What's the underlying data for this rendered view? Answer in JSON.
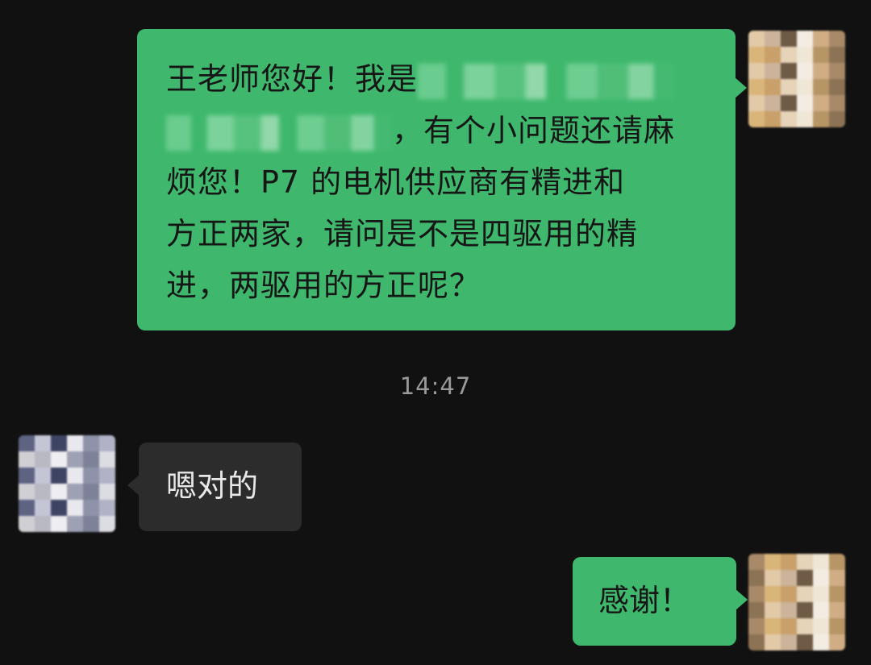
{
  "messages": [
    {
      "sender": "me",
      "lines": [
        [
          "王老师您好！我是",
          "[redacted]"
        ],
        [
          "[redacted]",
          "，有个小问题还请麻"
        ],
        [
          "烦您！P7 的电机供应商有精进和"
        ],
        [
          "方正两家，请问是不是四驱用的精"
        ],
        [
          "进，两驱用的方正呢？"
        ]
      ],
      "text_1": "王老师您好！我是",
      "text_2": "，有个小问题还请麻",
      "text_3": "烦您！P7 的电机供应商有精进和",
      "text_4": "方正两家，请问是不是四驱用的精",
      "text_5": "进，两驱用的方正呢？"
    },
    {
      "sender": "other",
      "text": "嗯对的"
    },
    {
      "sender": "me",
      "text": "感谢！"
    }
  ],
  "timestamp": "14:47",
  "colors": {
    "background": "#111111",
    "my_bubble": "#3fb86d",
    "their_bubble": "#2c2c2c",
    "timestamp_text": "#9a9a9a"
  }
}
